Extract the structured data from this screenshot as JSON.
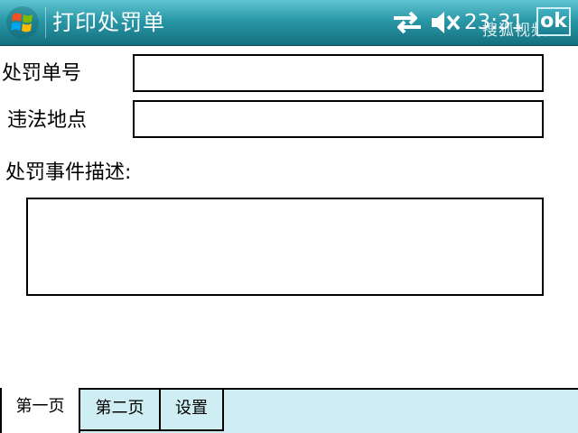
{
  "titlebar": {
    "title": "打印处罚单",
    "clock": "23:31",
    "ok_label": "ok",
    "watermark": "搜狐视频",
    "icons": [
      "windows-start-icon",
      "sync-arrows-icon",
      "speaker-mute-icon"
    ]
  },
  "form": {
    "penalty_number_label": "处罚单号",
    "penalty_number_value": "",
    "location_label": "违法地点",
    "location_value": "",
    "description_label": "处罚事件描述:",
    "description_value": ""
  },
  "tabs": [
    {
      "label": "第一页",
      "active": true
    },
    {
      "label": "第二页",
      "active": false
    },
    {
      "label": "设置",
      "active": false
    }
  ],
  "colors": {
    "titlebar": "#2a98a8",
    "tabbar": "#cfeef3",
    "text": "#000000"
  }
}
